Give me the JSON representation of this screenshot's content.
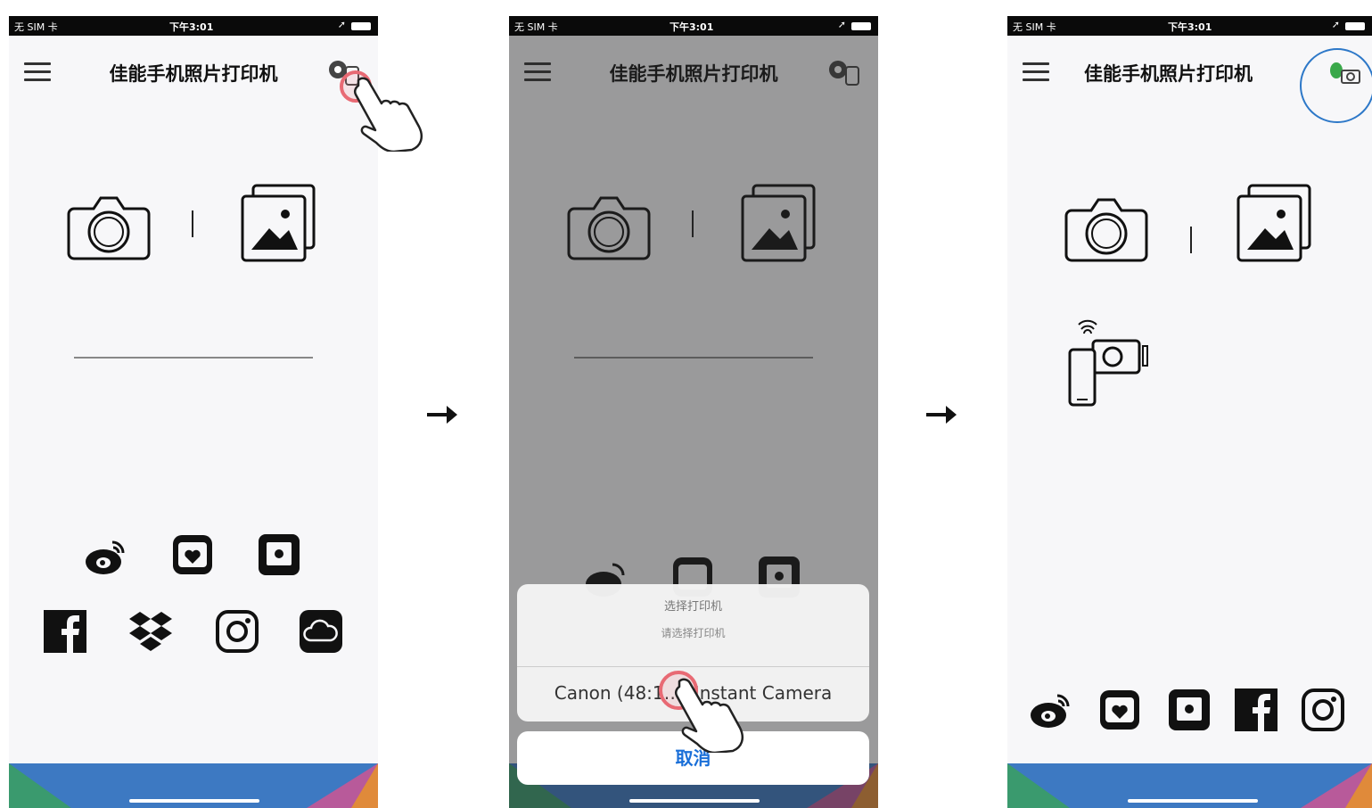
{
  "screens": [
    {
      "status": {
        "carrier": "无 SIM 卡",
        "time": "下午3:01"
      },
      "title": "佳能手机照片打印机"
    },
    {
      "status": {
        "carrier": "无 SIM 卡",
        "time": "下午3:01"
      },
      "title": "佳能手机照片打印机",
      "sheet": {
        "title": "选择打印机",
        "subtitle": "请选择打印机",
        "option": "Canon (48:1…) Instant Camera",
        "cancel": "取消"
      }
    },
    {
      "status": {
        "carrier": "无 SIM 卡",
        "time": "下午3:01"
      },
      "title": "佳能手机照片打印机"
    }
  ],
  "icons": {
    "hamburger": "menu-icon",
    "connect": "printer-connect-icon",
    "camera": "camera-icon",
    "gallery": "gallery-icon",
    "social": [
      "weibo-icon",
      "instagram-camera-icon",
      "photo-frame-icon",
      "facebook-icon",
      "dropbox-icon",
      "instagram-icon",
      "icloud-icon"
    ]
  },
  "colors": {
    "tap": "#e86a74",
    "highlight": "#2d78c8",
    "cancel": "#1a6fd8",
    "connected": "#3aa84a"
  }
}
